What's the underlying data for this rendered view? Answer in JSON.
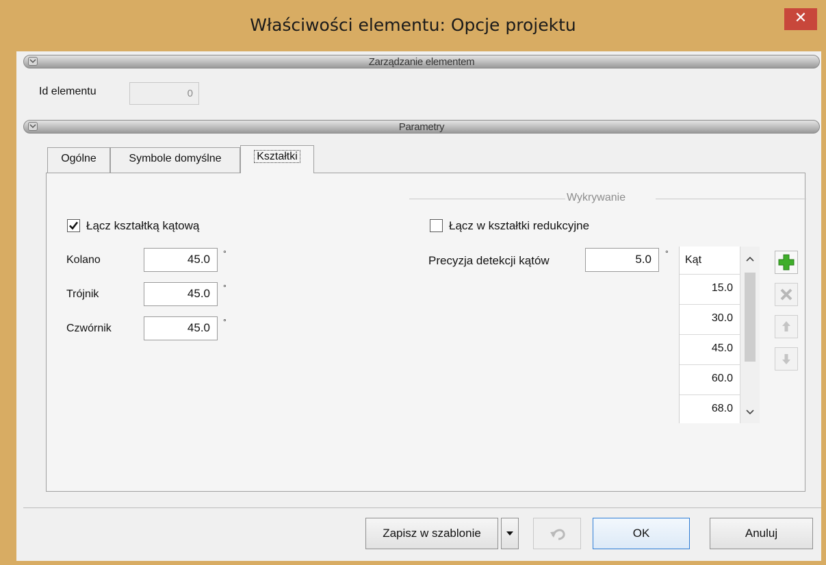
{
  "window": {
    "title": "Właściwości elementu: Opcje projektu",
    "close_glyph": "✕"
  },
  "management": {
    "section_label": "Zarządzanie elementem",
    "id_label": "Id elementu",
    "id_value": "0"
  },
  "params": {
    "section_label": "Parametry",
    "tabs": [
      {
        "label": "Ogólne",
        "active": false
      },
      {
        "label": "Symbole domyślne",
        "active": false
      },
      {
        "label": "Kształtki",
        "active": true
      }
    ]
  },
  "fittings": {
    "angle_fitting_checkbox_label": "Łącz kształtką kątową",
    "angle_fitting_checked": true,
    "fields": [
      {
        "label": "Kolano",
        "value": "45.0",
        "unit": "°"
      },
      {
        "label": "Trójnik",
        "value": "45.0",
        "unit": "°"
      },
      {
        "label": "Czwórnik",
        "value": "45.0",
        "unit": "°"
      }
    ]
  },
  "detection": {
    "group_label": "Wykrywanie",
    "reduction_checkbox_label": "Łącz w kształtki redukcyjne",
    "reduction_checked": false,
    "precision_label": "Precyzja detekcji kątów",
    "precision_value": "5.0",
    "precision_unit": "°",
    "angles_header": "Kąt",
    "angles": [
      "15.0",
      "30.0",
      "45.0",
      "60.0",
      "68.0"
    ],
    "side_buttons": [
      {
        "icon": "plus-icon",
        "enabled": true
      },
      {
        "icon": "delete-icon",
        "enabled": false
      },
      {
        "icon": "arrow-up-icon",
        "enabled": false
      },
      {
        "icon": "arrow-down-icon",
        "enabled": false
      }
    ]
  },
  "footer": {
    "save_template_label": "Zapisz w szablonie",
    "ok_label": "OK",
    "cancel_label": "Anuluj"
  },
  "colors": {
    "frame": "#d8ac63",
    "close": "#c8473b",
    "add_green": "#3fae2a",
    "ok_border": "#2c7bd6"
  }
}
